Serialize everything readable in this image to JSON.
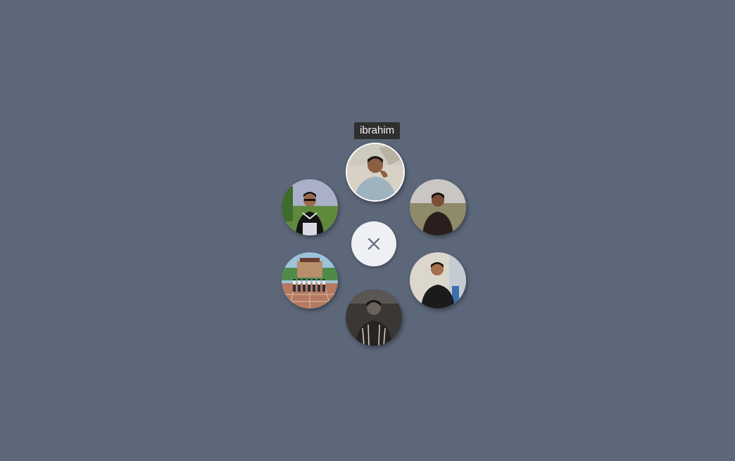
{
  "tooltip": {
    "label": "ibrahim"
  },
  "center_button": {
    "icon": "close-icon"
  },
  "avatars": [
    {
      "name": "avatar-top",
      "icon": "person-photo",
      "active": true
    },
    {
      "name": "avatar-upper-right",
      "icon": "person-photo",
      "active": false
    },
    {
      "name": "avatar-lower-right",
      "icon": "person-photo",
      "active": false
    },
    {
      "name": "avatar-bottom",
      "icon": "person-photo",
      "active": false
    },
    {
      "name": "avatar-lower-left",
      "icon": "group-photo",
      "active": false
    },
    {
      "name": "avatar-upper-left",
      "icon": "person-photo",
      "active": false
    }
  ],
  "colors": {
    "background": "#5c6779",
    "tooltip_bg": "#2f2f2f",
    "tooltip_text": "#f2f2f2",
    "center_button_bg": "#eef0f3",
    "close_icon": "#5c6779"
  }
}
